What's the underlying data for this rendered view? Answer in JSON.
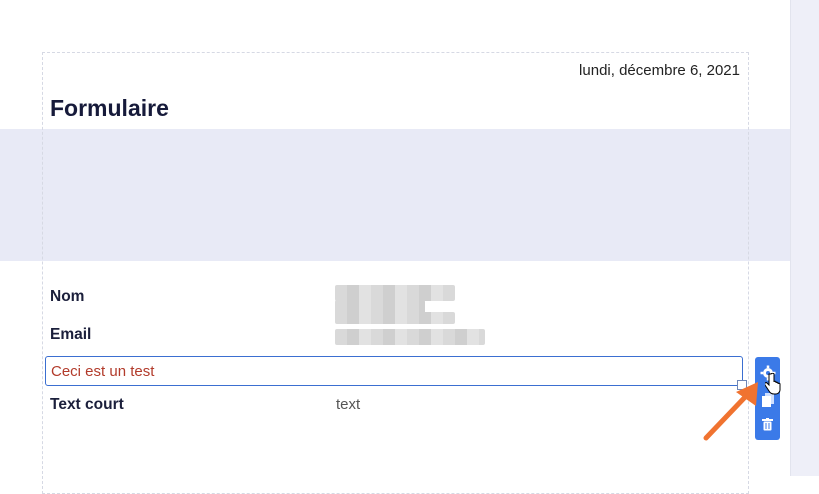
{
  "form": {
    "date": "lundi, décembre 6, 2021",
    "title": "Formulaire",
    "fields": [
      {
        "label": "Nom"
      },
      {
        "label": "Email"
      }
    ],
    "selected_text": "Ceci est un test",
    "short_text": {
      "label": "Text court",
      "value": "text"
    }
  },
  "toolbar": {
    "icons": [
      "gear-icon",
      "copy-icon",
      "trash-icon"
    ]
  },
  "colors": {
    "accent": "#3b7ae8",
    "annotation_arrow": "#f07330",
    "band": "#e8eaf6",
    "selected_text": "#b23b2b"
  }
}
